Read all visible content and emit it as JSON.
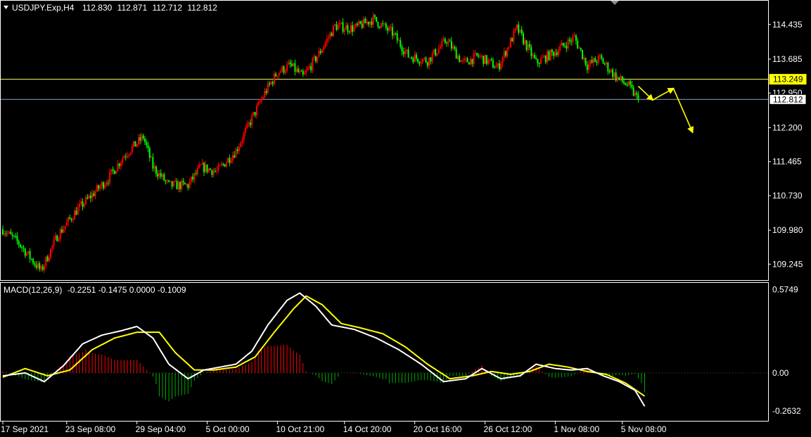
{
  "header": {
    "symbol": "USDJPY.Exp,H4",
    "open": "112.830",
    "high": "112.871",
    "low": "112.712",
    "close": "112.812"
  },
  "macd_header": {
    "label": "MACD(12,26,9)",
    "values": "-0.2251 -0.1475 0.0000 -0.1009"
  },
  "colors": {
    "background": "#000000",
    "bull": "#ff0000",
    "bear": "#00ff00",
    "hline_resistance": "#ffff66",
    "hline_current": "#8fa6c8",
    "macd_line": "#ffffff",
    "signal_line": "#ffff00",
    "hist_positive": "#ff0000",
    "hist_negative": "#00aa00",
    "arrow": "#ffff00",
    "frame": "#ffffff"
  },
  "chart_data": [
    {
      "type": "candlestick",
      "title": "USDJPY.Exp,H4",
      "ylim": [
        108.9,
        114.95
      ],
      "y_ticks": [
        "114.435",
        "113.685",
        "112.950",
        "112.200",
        "111.465",
        "110.730",
        "109.980",
        "109.245"
      ],
      "levels": [
        {
          "label": "113.249",
          "value": 113.249
        },
        {
          "label": "112.812",
          "value": 112.812
        }
      ],
      "price_path": [
        {
          "i": 0,
          "p": 110.0
        },
        {
          "i": 10,
          "p": 109.7
        },
        {
          "i": 18,
          "p": 109.35
        },
        {
          "i": 24,
          "p": 109.1
        },
        {
          "i": 34,
          "p": 109.85
        },
        {
          "i": 46,
          "p": 110.4
        },
        {
          "i": 56,
          "p": 110.75
        },
        {
          "i": 66,
          "p": 111.1
        },
        {
          "i": 76,
          "p": 111.6
        },
        {
          "i": 88,
          "p": 112.0
        },
        {
          "i": 94,
          "p": 111.35
        },
        {
          "i": 104,
          "p": 110.95
        },
        {
          "i": 116,
          "p": 110.95
        },
        {
          "i": 124,
          "p": 111.35
        },
        {
          "i": 134,
          "p": 111.25
        },
        {
          "i": 146,
          "p": 111.7
        },
        {
          "i": 156,
          "p": 112.4
        },
        {
          "i": 164,
          "p": 112.95
        },
        {
          "i": 172,
          "p": 113.4
        },
        {
          "i": 180,
          "p": 113.55
        },
        {
          "i": 188,
          "p": 113.3
        },
        {
          "i": 198,
          "p": 113.8
        },
        {
          "i": 208,
          "p": 114.4
        },
        {
          "i": 220,
          "p": 114.35
        },
        {
          "i": 232,
          "p": 114.55
        },
        {
          "i": 244,
          "p": 114.25
        },
        {
          "i": 254,
          "p": 113.75
        },
        {
          "i": 266,
          "p": 113.65
        },
        {
          "i": 278,
          "p": 114.1
        },
        {
          "i": 288,
          "p": 113.6
        },
        {
          "i": 298,
          "p": 113.75
        },
        {
          "i": 310,
          "p": 113.5
        },
        {
          "i": 322,
          "p": 114.35
        },
        {
          "i": 334,
          "p": 113.6
        },
        {
          "i": 346,
          "p": 113.85
        },
        {
          "i": 358,
          "p": 114.15
        },
        {
          "i": 366,
          "p": 113.55
        },
        {
          "i": 374,
          "p": 113.7
        },
        {
          "i": 384,
          "p": 113.3
        },
        {
          "i": 392,
          "p": 113.1
        },
        {
          "i": 398,
          "p": 112.8
        }
      ],
      "projection": [
        {
          "i": 398,
          "p": 113.1
        },
        {
          "i": 407,
          "p": 112.8
        },
        {
          "i": 420,
          "p": 113.05
        },
        {
          "i": 432,
          "p": 112.1
        }
      ]
    },
    {
      "type": "line",
      "title": "MACD(12,26,9)",
      "ylim": [
        -0.33,
        0.62
      ],
      "y_ticks": [
        "0.5749",
        "0.00",
        "-0.2632"
      ],
      "x_ticks": [
        "17 Sep 2021",
        "23 Sep 08:00",
        "29 Sep 04:00",
        "5 Oct 00:00",
        "10 Oct 21:00",
        "14 Oct 20:00",
        "20 Oct 16:00",
        "26 Oct 12:00",
        "1 Nov 08:00",
        "5 Nov 08:00"
      ],
      "x_tick_index": [
        0,
        40,
        84,
        128,
        172,
        214,
        258,
        302,
        346,
        388
      ],
      "macd_path": [
        {
          "i": 0,
          "p": -0.02
        },
        {
          "i": 14,
          "p": 0.0
        },
        {
          "i": 26,
          "p": -0.06
        },
        {
          "i": 38,
          "p": 0.05
        },
        {
          "i": 50,
          "p": 0.2
        },
        {
          "i": 62,
          "p": 0.26
        },
        {
          "i": 74,
          "p": 0.29
        },
        {
          "i": 84,
          "p": 0.32
        },
        {
          "i": 94,
          "p": 0.24
        },
        {
          "i": 104,
          "p": 0.06
        },
        {
          "i": 116,
          "p": -0.04
        },
        {
          "i": 126,
          "p": 0.02
        },
        {
          "i": 136,
          "p": 0.04
        },
        {
          "i": 146,
          "p": 0.06
        },
        {
          "i": 156,
          "p": 0.15
        },
        {
          "i": 166,
          "p": 0.33
        },
        {
          "i": 178,
          "p": 0.5
        },
        {
          "i": 186,
          "p": 0.55
        },
        {
          "i": 196,
          "p": 0.46
        },
        {
          "i": 206,
          "p": 0.33
        },
        {
          "i": 220,
          "p": 0.3
        },
        {
          "i": 234,
          "p": 0.24
        },
        {
          "i": 248,
          "p": 0.16
        },
        {
          "i": 262,
          "p": 0.06
        },
        {
          "i": 276,
          "p": -0.06
        },
        {
          "i": 290,
          "p": -0.04
        },
        {
          "i": 300,
          "p": 0.03
        },
        {
          "i": 312,
          "p": -0.04
        },
        {
          "i": 324,
          "p": -0.02
        },
        {
          "i": 334,
          "p": 0.06
        },
        {
          "i": 346,
          "p": 0.03
        },
        {
          "i": 356,
          "p": 0.02
        },
        {
          "i": 366,
          "p": 0.03
        },
        {
          "i": 376,
          "p": -0.02
        },
        {
          "i": 386,
          "p": -0.06
        },
        {
          "i": 396,
          "p": -0.12
        },
        {
          "i": 402,
          "p": -0.23
        }
      ],
      "signal_path": [
        {
          "i": 0,
          "p": -0.03
        },
        {
          "i": 14,
          "p": 0.03
        },
        {
          "i": 28,
          "p": -0.02
        },
        {
          "i": 42,
          "p": 0.02
        },
        {
          "i": 56,
          "p": 0.16
        },
        {
          "i": 70,
          "p": 0.24
        },
        {
          "i": 84,
          "p": 0.28
        },
        {
          "i": 98,
          "p": 0.28
        },
        {
          "i": 108,
          "p": 0.14
        },
        {
          "i": 120,
          "p": 0.02
        },
        {
          "i": 132,
          "p": 0.02
        },
        {
          "i": 146,
          "p": 0.04
        },
        {
          "i": 158,
          "p": 0.11
        },
        {
          "i": 170,
          "p": 0.28
        },
        {
          "i": 182,
          "p": 0.44
        },
        {
          "i": 190,
          "p": 0.53
        },
        {
          "i": 200,
          "p": 0.47
        },
        {
          "i": 212,
          "p": 0.34
        },
        {
          "i": 224,
          "p": 0.31
        },
        {
          "i": 238,
          "p": 0.27
        },
        {
          "i": 252,
          "p": 0.18
        },
        {
          "i": 266,
          "p": 0.06
        },
        {
          "i": 280,
          "p": -0.04
        },
        {
          "i": 294,
          "p": -0.02
        },
        {
          "i": 306,
          "p": 0.01
        },
        {
          "i": 318,
          "p": -0.01
        },
        {
          "i": 330,
          "p": 0.01
        },
        {
          "i": 342,
          "p": 0.06
        },
        {
          "i": 354,
          "p": 0.04
        },
        {
          "i": 366,
          "p": 0.01
        },
        {
          "i": 378,
          "p": -0.01
        },
        {
          "i": 390,
          "p": -0.07
        },
        {
          "i": 402,
          "p": -0.16
        }
      ]
    }
  ]
}
